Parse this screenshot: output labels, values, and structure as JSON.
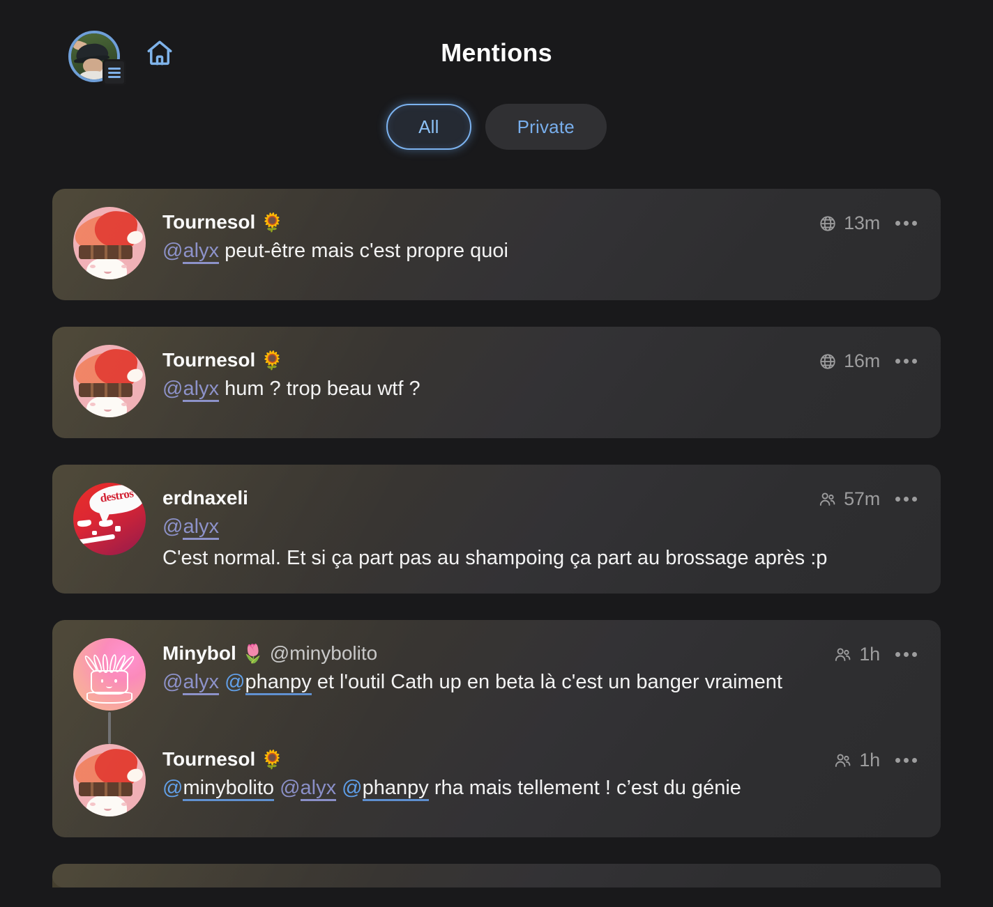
{
  "header": {
    "title": "Mentions",
    "account_avatar_name": "account-avatar",
    "menu_icon": "list-menu-icon",
    "home_icon": "home-icon"
  },
  "filters": {
    "items": [
      {
        "label": "All",
        "selected": true
      },
      {
        "label": "Private",
        "selected": false
      }
    ],
    "accent": "#7cb3f0",
    "inactive_bg": "#303033"
  },
  "colors": {
    "background": "#19191b",
    "card_warm": "#46402f",
    "card_cool": "#2c2c2e",
    "mention_lavender": "#8a8fc8",
    "mention_blue": "#5e9ee8",
    "meta_gray": "#9d9d9e"
  },
  "statuses": [
    {
      "avatar": "tournesol",
      "display_name": "Tournesol",
      "emoji": "🌻",
      "handle": "",
      "visibility_icon": "globe-icon",
      "time": "13m",
      "lines": [
        [
          {
            "type": "mention",
            "at": "@",
            "user": "alyx",
            "style": "lav"
          },
          {
            "type": "text",
            "text": " peut-être mais c'est propre quoi"
          }
        ]
      ]
    },
    {
      "avatar": "tournesol",
      "display_name": "Tournesol",
      "emoji": "🌻",
      "handle": "",
      "visibility_icon": "globe-icon",
      "time": "16m",
      "lines": [
        [
          {
            "type": "mention",
            "at": "@",
            "user": "alyx",
            "style": "lav"
          },
          {
            "type": "text",
            "text": " hum ? trop beau wtf ?"
          }
        ]
      ]
    },
    {
      "avatar": "erdnaxeli",
      "avatar_bubble_text": "destros",
      "display_name": "erdnaxeli",
      "emoji": "",
      "handle": "",
      "visibility_icon": "people-icon",
      "time": "57m",
      "lines": [
        [
          {
            "type": "mention",
            "at": "@",
            "user": "alyx",
            "style": "lav"
          }
        ],
        [
          {
            "type": "text",
            "text": "C'est normal. Et si ça part pas au shampoing ça part au brossage après :p"
          }
        ]
      ]
    },
    {
      "group": true,
      "thread": [
        {
          "avatar": "minybol",
          "display_name": "Minybol",
          "emoji": "🌷",
          "handle": "@minybolito",
          "visibility_icon": "people-icon",
          "time": "1h",
          "thread_line_above": false,
          "lines": [
            [
              {
                "type": "mention",
                "at": "@",
                "user": "alyx",
                "style": "lav"
              },
              {
                "type": "text",
                "text": " "
              },
              {
                "type": "mention",
                "at": "@",
                "user": "phanpy",
                "style": "blu"
              },
              {
                "type": "text",
                "text": " et l'outil Cath up en beta là c'est un banger vraiment"
              }
            ]
          ]
        },
        {
          "avatar": "tournesol",
          "display_name": "Tournesol",
          "emoji": "🌻",
          "handle": "",
          "visibility_icon": "people-icon",
          "time": "1h",
          "thread_line_above": true,
          "lines": [
            [
              {
                "type": "mention",
                "at": "@",
                "user": "minybolito",
                "style": "blu"
              },
              {
                "type": "text",
                "text": " "
              },
              {
                "type": "mention",
                "at": "@",
                "user": "alyx",
                "style": "lav"
              },
              {
                "type": "text",
                "text": " "
              },
              {
                "type": "mention",
                "at": "@",
                "user": "phanpy",
                "style": "blu"
              },
              {
                "type": "text",
                "text": " rha mais tellement ! c’est du génie"
              }
            ]
          ]
        }
      ]
    }
  ]
}
